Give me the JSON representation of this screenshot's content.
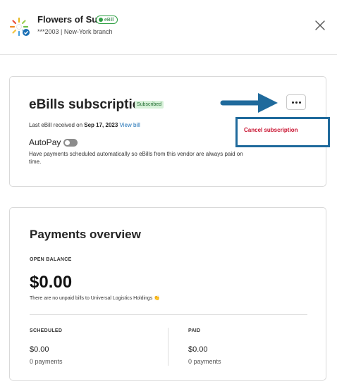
{
  "vendor": {
    "name": "Flowers of Sun",
    "ebill_badge": "eBill",
    "subtitle": "***2003 | New-York branch",
    "avatar_icon": "sunflower-logo",
    "verified_icon": "check-badge-icon"
  },
  "subscription": {
    "title": "eBills subscription",
    "status_badge": "Subscribed",
    "last_ebill_prefix": "Last eBill received on ",
    "last_ebill_date": "Sep 17, 2023",
    "view_bill_link": "View bill",
    "autopay_label": "AutoPay",
    "autopay_on": false,
    "autopay_desc": "Have payments scheduled automatically so eBills from this vendor are always paid on time.",
    "more_icon": "ellipsis-icon",
    "menu": {
      "cancel_label": "Cancel subscription"
    }
  },
  "payments": {
    "title": "Payments overview",
    "open_balance_label": "OPEN BALANCE",
    "open_balance_amount": "$0.00",
    "open_balance_note": "There are no unpaid bills to Universal Logistics Holdings 👏",
    "scheduled": {
      "label": "SCHEDULED",
      "amount": "$0.00",
      "count": "0 payments"
    },
    "paid": {
      "label": "PAID",
      "amount": "$0.00",
      "count": "0 payments"
    }
  },
  "colors": {
    "accent_blue": "#1a6fb5",
    "annotation_blue": "#1f6a9c",
    "cancel_red": "#c8102e",
    "success_green": "#2ea043"
  }
}
